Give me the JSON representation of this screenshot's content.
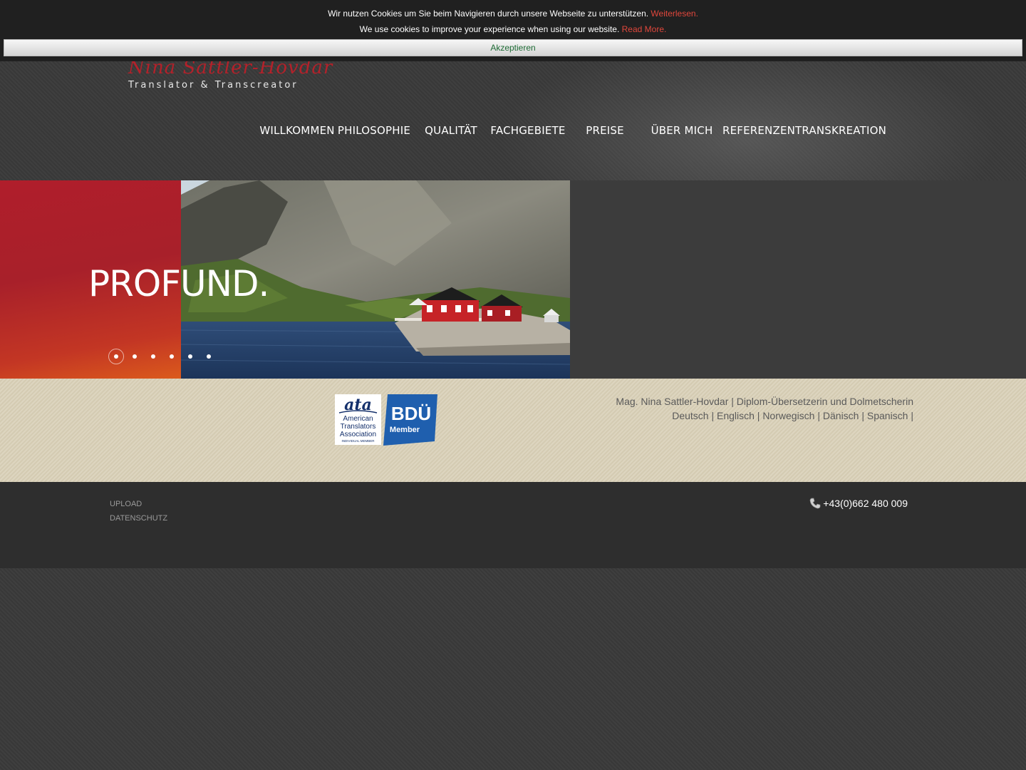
{
  "cookie": {
    "de_text": "Wir nutzen Cookies um Sie beim Navigieren durch unsere Webseite zu unterstützen.",
    "de_link": "Weiterlesen.",
    "en_text": "We use cookies to improve your experience when using our website.",
    "en_link": "Read More.",
    "accept_label": "Akzeptieren"
  },
  "header": {
    "logo_name": "Nina Sattler-Hovdar",
    "logo_tagline": "Translator & Transcreator"
  },
  "nav": {
    "items": [
      {
        "label": "WILLKOMMEN"
      },
      {
        "label": "PHILOSOPHIE"
      },
      {
        "label": "QUALITÄT"
      },
      {
        "label": "FACHGEBIETE"
      },
      {
        "label": "PREISE"
      },
      {
        "label": "ÜBER MICH"
      },
      {
        "label": "REFERENZEN"
      },
      {
        "label": "TRANSKREATION"
      }
    ]
  },
  "hero": {
    "title": "PROFUND.",
    "slide_count": 6,
    "active_slide": 1
  },
  "info": {
    "ata_logo_text": [
      "ata",
      "American",
      "Translators",
      "Association",
      "INDIVIDUAL MEMBER"
    ],
    "bdu_logo_text": [
      "BDÜ",
      "Member"
    ],
    "line1": "Mag. Nina Sattler-Hovdar | Diplom-Übersetzerin und Dolmetscherin",
    "line2": "Deutsch | Englisch | Norwegisch | Dänisch | Spanisch |"
  },
  "footer": {
    "upload_label": "UPLOAD",
    "privacy_label": "DATENSCHUTZ",
    "phone": "+43(0)662 480 009",
    "phone_icon": "phone-icon"
  },
  "colors": {
    "brand_red": "#b3212a",
    "cookie_link": "#e0473c",
    "accept_text": "#1e6b35",
    "info_band": "#d8cfb6",
    "footer_bg": "#2e2e2e"
  }
}
